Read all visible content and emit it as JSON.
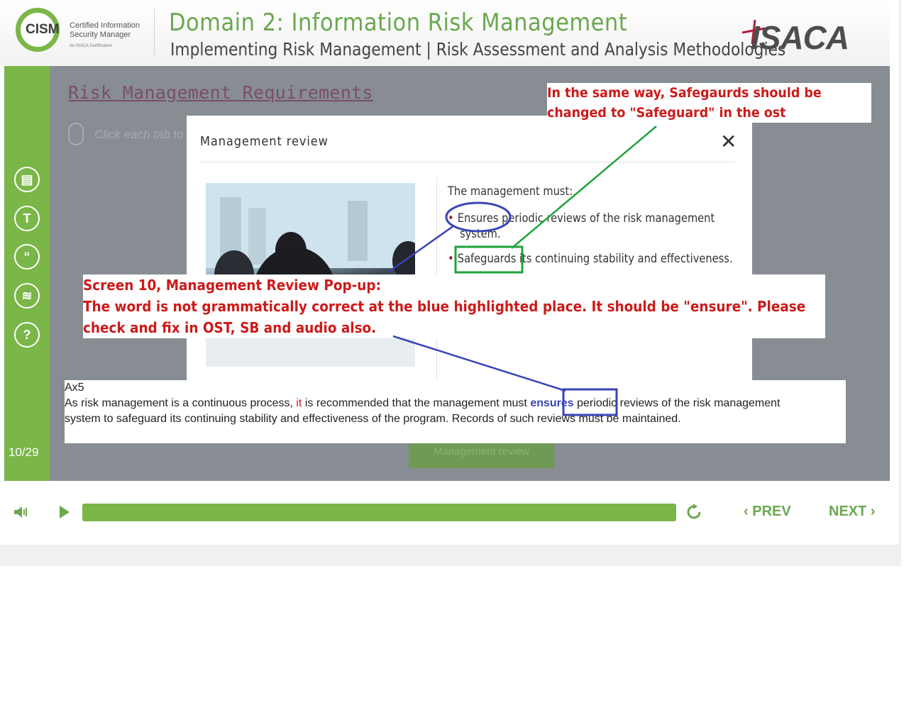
{
  "header": {
    "logo_text": "CISM",
    "logo_subtitle": "Certified Information Security Manager",
    "logo_tagline": "An ISACA Certification",
    "domain_title": "Domain 2: Information Risk Management",
    "subtitle": "Implementing Risk Management | Risk Assessment and Analysis Methodologies",
    "brand": "ISACA"
  },
  "sidebar": {
    "buttons": [
      {
        "name": "notes-icon",
        "glyph": "▤"
      },
      {
        "name": "transcript-icon",
        "glyph": "T"
      },
      {
        "name": "quote-icon",
        "glyph": "“"
      },
      {
        "name": "layers-icon",
        "glyph": "≋"
      },
      {
        "name": "help-icon",
        "glyph": "?"
      }
    ],
    "page_count": "10/29"
  },
  "content": {
    "title": "Risk Management Requirements",
    "click_hint": "Click each tab to l",
    "tab_label": "Management review"
  },
  "modal": {
    "title": "Management review",
    "close_glyph": "✕",
    "intro": "The management must:",
    "bullets": [
      {
        "line1": "Ensures periodic reviews of the risk management",
        "line2": "system."
      },
      {
        "line1": "Safeguards its continuing stability and effectiveness."
      }
    ]
  },
  "controls": {
    "prev_label": "PREV",
    "next_label": "NEXT",
    "progress": 1.0
  },
  "annotations": {
    "note1": {
      "line1": "In the same way, Safegaurds should be",
      "line2": "changed to \"Safeguard\" in the ost"
    },
    "note2": {
      "line1": "Screen 10, Management Review Pop-up:",
      "line2": "The word is not grammatically correct at the blue highlighted place. It should be \"ensure\". Please",
      "line3": "check and fix in OST, SB and audio also."
    },
    "note3": {
      "ref": "Ax5",
      "text_a": "As risk management is a continuous process, ",
      "text_red": "it",
      "text_b": " is recommended that the management must ",
      "text_hl": "ensures",
      "text_c": " periodic reviews of the risk management",
      "line2": "system to safeguard its continuing stability and effectiveness of the program. Records of such reviews must be maintained."
    }
  },
  "colors": {
    "brand_green": "#7ab648",
    "content_gray": "#878d92",
    "note_red": "#cc1a1a",
    "highlight_blue": "#3a44b8",
    "highlight_green": "#1fa33a"
  }
}
